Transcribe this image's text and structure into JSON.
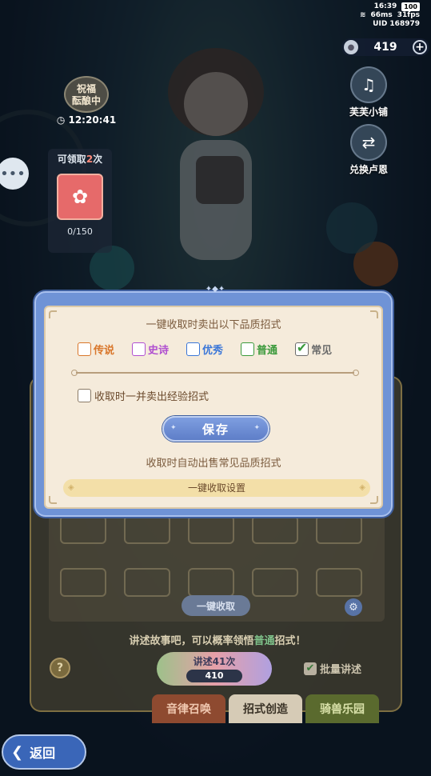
{
  "status_bar": {
    "time": "16:39",
    "battery": "100",
    "ping": "66ms",
    "fps": "31fps",
    "uid": "UID 168979"
  },
  "currency": {
    "amount": "419",
    "plus": "+"
  },
  "side_buttons": [
    {
      "label": "芙芙小铺",
      "icon": "shop-icon"
    },
    {
      "label": "兑换卢恩",
      "icon": "exchange-icon"
    }
  ],
  "blessing": {
    "badge_line1": "祝福",
    "badge_line2": "酝酿中",
    "timer": "12:20:41"
  },
  "claim_panel": {
    "prefix": "可领取",
    "count": "2",
    "suffix": "次",
    "progress": "0/150"
  },
  "dialog": {
    "title": "一键收取时卖出以下品质招式",
    "options": [
      {
        "label": "传说",
        "color": "#d9762a",
        "checked": false
      },
      {
        "label": "史诗",
        "color": "#b04fd0",
        "checked": false
      },
      {
        "label": "优秀",
        "color": "#3a76d8",
        "checked": false
      },
      {
        "label": "普通",
        "color": "#3c9a3c",
        "checked": false
      },
      {
        "label": "常见",
        "color": "#6b6b6b",
        "checked": true
      }
    ],
    "exp_option": {
      "label": "收取时一并卖出经验招式",
      "checked": false
    },
    "save_label": "保存",
    "auto_text": "收取时自动出售常见品质招式",
    "setting_label": "一键收取设置"
  },
  "lower_panel": {
    "oneclick_label": "一键收取",
    "story_prefix": "讲述故事吧，可以概率领悟",
    "story_highlight": "普通",
    "story_suffix": "招式！",
    "narrate_label": "讲述41次",
    "narrate_cost": "410",
    "batch_label": "批量讲述",
    "help_label": "?"
  },
  "tabs": [
    {
      "label": "音律召唤"
    },
    {
      "label": "招式创造"
    },
    {
      "label": "骑兽乐园"
    }
  ],
  "back_label": "返回"
}
